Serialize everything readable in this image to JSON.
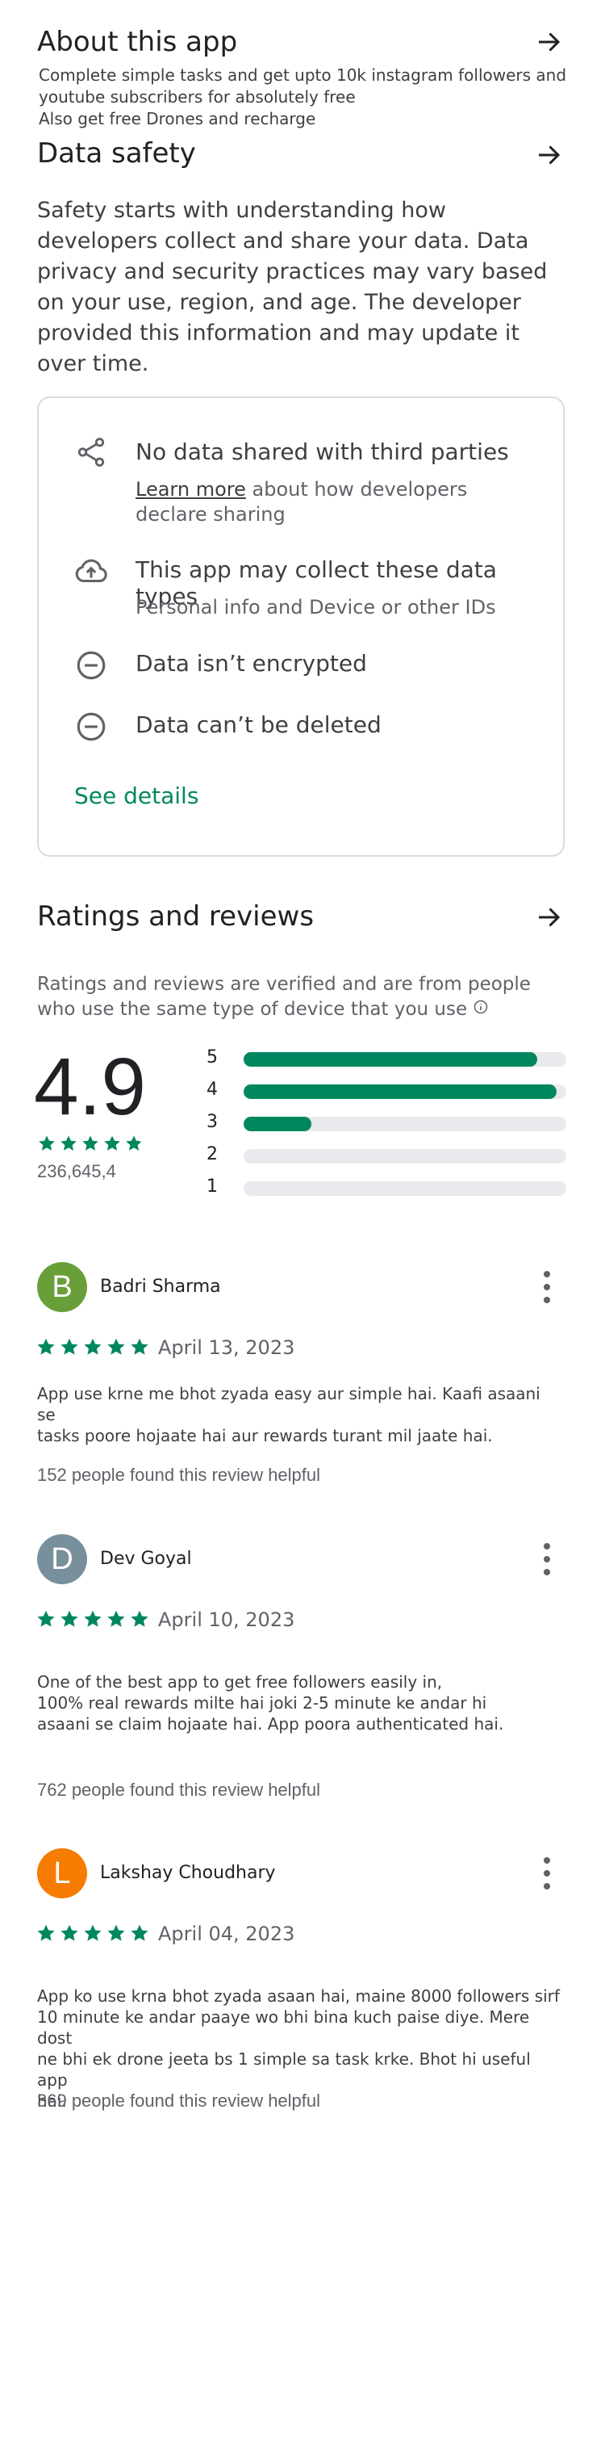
{
  "about": {
    "title": "About this app",
    "lines": [
      "Complete simple tasks and get upto 10k instagram followers and",
      "youtube subscribers for absolutely free",
      "Also get free Drones and recharge"
    ]
  },
  "data_safety": {
    "title": "Data safety",
    "description": "Safety starts with understanding how developers collect and share your data. Data privacy and security practices may vary based on your use, region, and age. The developer provided this information and may update it over time.",
    "items": [
      {
        "icon": "share-icon",
        "title": "No data shared with third parties",
        "link": "Learn more",
        "subtitle": " about how developers declare sharing"
      },
      {
        "icon": "cloud-upload-icon",
        "title": "This app may collect these data types",
        "subtitle": "Personal info and Device or other IDs"
      },
      {
        "icon": "no-entry-icon",
        "title": "Data isn’t encrypted"
      },
      {
        "icon": "no-entry-icon",
        "title": "Data can’t be deleted"
      }
    ],
    "see_details": "See details"
  },
  "ratings": {
    "title": "Ratings and reviews",
    "note": "Ratings and reviews are verified and are from people who use the same type of device that you use",
    "score": "4.9",
    "count": "236,645,4",
    "star_rating": 4.9,
    "bars": [
      {
        "label": "5",
        "fraction": 0.91
      },
      {
        "label": "4",
        "fraction": 0.97
      },
      {
        "label": "3",
        "fraction": 0.21
      },
      {
        "label": "2",
        "fraction": 0
      },
      {
        "label": "1",
        "fraction": 0
      }
    ]
  },
  "reviews": [
    {
      "initial": "B",
      "avatar_color": "#689f38",
      "name": "Badri Sharma",
      "date": "April 13, 2023",
      "stars": 5,
      "lines": [
        "App use krne me bhot zyada easy aur simple hai. Kaafi asaani se",
        "tasks poore hojaate hai aur rewards turant mil jaate hai."
      ],
      "helpful": "152 people found this review helpful"
    },
    {
      "initial": "D",
      "avatar_color": "#78909c",
      "name": "Dev Goyal",
      "date": "April 10, 2023",
      "stars": 5,
      "lines": [
        "One of the best app to get free followers easily in,",
        "100% real rewards milte hai joki 2-5 minute ke andar hi",
        "asaani se claim hojaate hai. App poora authenticated hai."
      ],
      "helpful": "762 people found this review helpful"
    },
    {
      "initial": "L",
      "avatar_color": "#f57c00",
      "name": "Lakshay Choudhary",
      "date": "April 04, 2023",
      "stars": 5,
      "lines": [
        "App ko use krna bhot zyada asaan hai, maine 8000 followers sirf",
        "10 minute ke andar paaye wo bhi bina kuch paise diye. Mere dost",
        "ne bhi ek drone jeeta bs 1 simple sa task krke. Bhot hi useful app",
        "hai."
      ],
      "helpful": "369 people found this review helpful"
    }
  ],
  "colors": {
    "accent": "#01875f",
    "text": "#202124",
    "muted": "#5f6368",
    "border": "#dadce0"
  }
}
